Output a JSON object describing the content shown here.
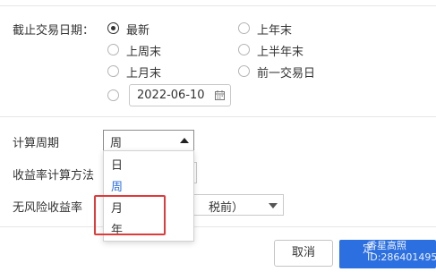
{
  "form": {
    "end_date_label": "截止交易日期：",
    "options": {
      "latest": "最新",
      "last_year_end": "上年末",
      "last_week_end": "上周末",
      "last_half_year_end": "上半年末",
      "last_month_end": "上月末",
      "previous_trading_day": "前一交易日"
    },
    "selected_option": "latest",
    "custom_date": "2022-06-10",
    "calc_period_label": "计算周期",
    "calc_period_value": "周",
    "return_method_label": "收益率计算方法",
    "risk_free_label": "无风险收益率",
    "risk_free_value_partial": "税前）"
  },
  "dropdown": {
    "options": [
      "日",
      "周",
      "月",
      "年"
    ],
    "highlighted": "周",
    "highlight_color": "#2b6fe0",
    "annotation_color": "#e03a3a"
  },
  "buttons": {
    "cancel": "取消",
    "ok_partial": "定"
  },
  "watermark": {
    "line1": "香星高照",
    "line2": "ID:286401495"
  },
  "icons": {
    "date_picker": "calendar-icon",
    "select_open": "caret-up-icon",
    "select_closed": "caret-down-icon"
  }
}
